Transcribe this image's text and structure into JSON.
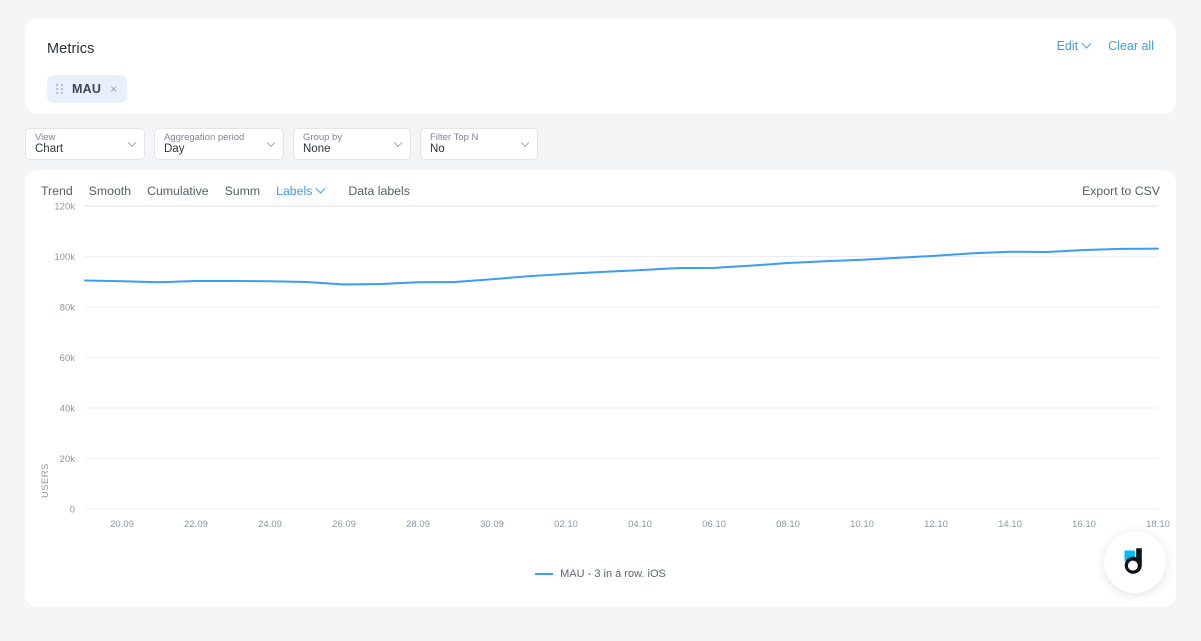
{
  "metrics_panel": {
    "title": "Metrics",
    "edit_label": "Edit",
    "clear_all_label": "Clear all",
    "chips": [
      {
        "label": "MAU",
        "close": "×"
      }
    ]
  },
  "filters": [
    {
      "name": "view",
      "label": "View",
      "value": "Chart"
    },
    {
      "name": "aggregation-period",
      "label": "Aggregation period",
      "value": "Day"
    },
    {
      "name": "group-by",
      "label": "Group by",
      "value": "None"
    },
    {
      "name": "filter-top-n",
      "label": "Filter Top N",
      "value": "No"
    }
  ],
  "chart_panel": {
    "tabs": [
      {
        "label": "Trend",
        "active": false
      },
      {
        "label": "Smooth",
        "active": false
      },
      {
        "label": "Cumulative",
        "active": false
      },
      {
        "label": "Summ",
        "active": false
      },
      {
        "label": "Labels",
        "active": true
      },
      {
        "label": "Data labels",
        "active": false
      }
    ],
    "export_label": "Export to CSV",
    "legend": "MAU - 3 in a row. iOS"
  },
  "colors": {
    "line": "#3b9cf0",
    "accent": "#3b9cf0",
    "chip_bg": "#e8f1fb",
    "page_bg": "#f4f5f7",
    "grid": "#ebedf0",
    "logo_cyan": "#00bdf2",
    "logo_dark": "#11131a"
  },
  "chart_data": {
    "type": "line",
    "title": "",
    "xlabel": "",
    "ylabel": "USERS",
    "ylim": [
      0,
      120000
    ],
    "ytick_labels": [
      "0",
      "20k",
      "40k",
      "60k",
      "80k",
      "100k",
      "120k"
    ],
    "yticks": [
      0,
      20000,
      40000,
      60000,
      80000,
      100000,
      120000
    ],
    "grid": true,
    "legend_position": "bottom",
    "x": [
      "19.09",
      "20.09",
      "21.09",
      "22.09",
      "23.09",
      "24.09",
      "25.09",
      "26.09",
      "27.09",
      "28.09",
      "29.09",
      "30.09",
      "01.10",
      "02.10",
      "03.10",
      "04.10",
      "05.10",
      "06.10",
      "07.10",
      "08.10",
      "09.10",
      "10.10",
      "11.10",
      "12.10",
      "13.10",
      "14.10",
      "15.10",
      "16.10",
      "17.10",
      "18.10"
    ],
    "xtick_labels": [
      "20.09",
      "22.09",
      "24.09",
      "26.09",
      "28.09",
      "30.09",
      "02.10",
      "04.10",
      "06.10",
      "08.10",
      "10.10",
      "12.10",
      "14.10",
      "16.10",
      "18.10"
    ],
    "series": [
      {
        "name": "MAU - 3 in a row. iOS",
        "color": "#3b9cf0",
        "values": [
          90500,
          90200,
          89800,
          90300,
          90300,
          90200,
          89900,
          88900,
          89100,
          89800,
          89900,
          91000,
          92200,
          93100,
          93900,
          94600,
          95400,
          95500,
          96400,
          97400,
          98100,
          98700,
          99500,
          100300,
          101300,
          101900,
          101800,
          102600,
          103000,
          103100
        ]
      }
    ]
  }
}
